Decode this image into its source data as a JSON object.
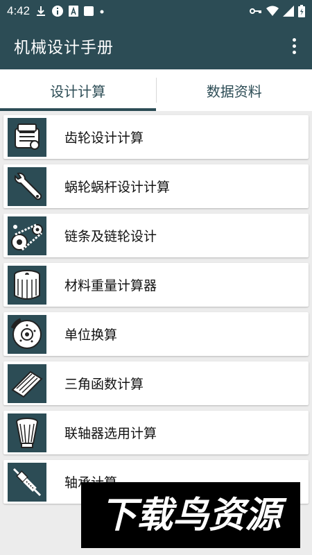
{
  "status_bar": {
    "time": "4:42"
  },
  "app_bar": {
    "title": "机械设计手册"
  },
  "tabs": [
    {
      "label": "设计计算",
      "active": true
    },
    {
      "label": "数据资料",
      "active": false
    }
  ],
  "items": [
    {
      "label": "齿轮设计计算",
      "icon": "engine-icon"
    },
    {
      "label": "蜗轮蜗杆设计计算",
      "icon": "wrench-icon"
    },
    {
      "label": "链条及链轮设计",
      "icon": "chain-icon"
    },
    {
      "label": "材料重量计算器",
      "icon": "oil-filter-icon"
    },
    {
      "label": "单位换算",
      "icon": "brake-disc-icon"
    },
    {
      "label": "三角函数计算",
      "icon": "air-filter-icon"
    },
    {
      "label": "联轴器选用计算",
      "icon": "cone-filter-icon"
    },
    {
      "label": "轴承计算",
      "icon": "spark-plug-icon"
    }
  ],
  "watermark": {
    "text": "下载鸟资源"
  },
  "colors": {
    "primary": "#2c4c55",
    "background": "#ececec"
  }
}
